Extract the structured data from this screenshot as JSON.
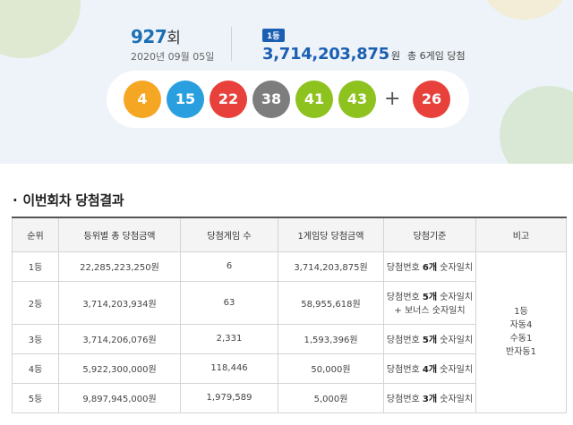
{
  "header": {
    "round_number": "927",
    "round_suffix": "회",
    "draw_date": "2020년 09월 05일",
    "rank_badge": "1등",
    "first_prize_amount": "3,714,203,875",
    "first_prize_unit": "원",
    "first_prize_games": "총 6게임 당첨"
  },
  "balls": {
    "numbers": [
      {
        "value": "4",
        "color": "#f5a623"
      },
      {
        "value": "15",
        "color": "#2a9fe0"
      },
      {
        "value": "22",
        "color": "#e8403a"
      },
      {
        "value": "38",
        "color": "#7d7d7d"
      },
      {
        "value": "41",
        "color": "#8dc21f"
      },
      {
        "value": "43",
        "color": "#8dc21f"
      }
    ],
    "plus": "+",
    "bonus": {
      "value": "26",
      "color": "#e8403a"
    }
  },
  "section": {
    "bullet": "·",
    "title": "이번회차 당첨결과"
  },
  "table": {
    "headers": [
      "순위",
      "등위별 총 당첨금액",
      "당첨게임 수",
      "1게임당 당첨금액",
      "당첨기준",
      "비고"
    ],
    "rows": [
      {
        "rank": "1등",
        "total": "22,285,223,250원",
        "games": "6",
        "per_game": "3,714,203,875원",
        "crit_pre": "당첨번호 ",
        "crit_bold": "6개",
        "crit_post": " 숫자일치",
        "crit_line2": ""
      },
      {
        "rank": "2등",
        "total": "3,714,203,934원",
        "games": "63",
        "per_game": "58,955,618원",
        "crit_pre": "당첨번호 ",
        "crit_bold": "5개",
        "crit_post": " 숫자일치",
        "crit_line2": "+ 보너스 숫자일치"
      },
      {
        "rank": "3등",
        "total": "3,714,206,076원",
        "games": "2,331",
        "per_game": "1,593,396원",
        "crit_pre": "당첨번호 ",
        "crit_bold": "5개",
        "crit_post": " 숫자일치",
        "crit_line2": ""
      },
      {
        "rank": "4등",
        "total": "5,922,300,000원",
        "games": "118,446",
        "per_game": "50,000원",
        "crit_pre": "당첨번호 ",
        "crit_bold": "4개",
        "crit_post": " 숫자일치",
        "crit_line2": ""
      },
      {
        "rank": "5등",
        "total": "9,897,945,000원",
        "games": "1,979,589",
        "per_game": "5,000원",
        "crit_pre": "당첨번호 ",
        "crit_bold": "3개",
        "crit_post": " 숫자일치",
        "crit_line2": ""
      }
    ],
    "note": [
      "1등",
      "자동4",
      "수동1",
      "반자동1"
    ]
  }
}
